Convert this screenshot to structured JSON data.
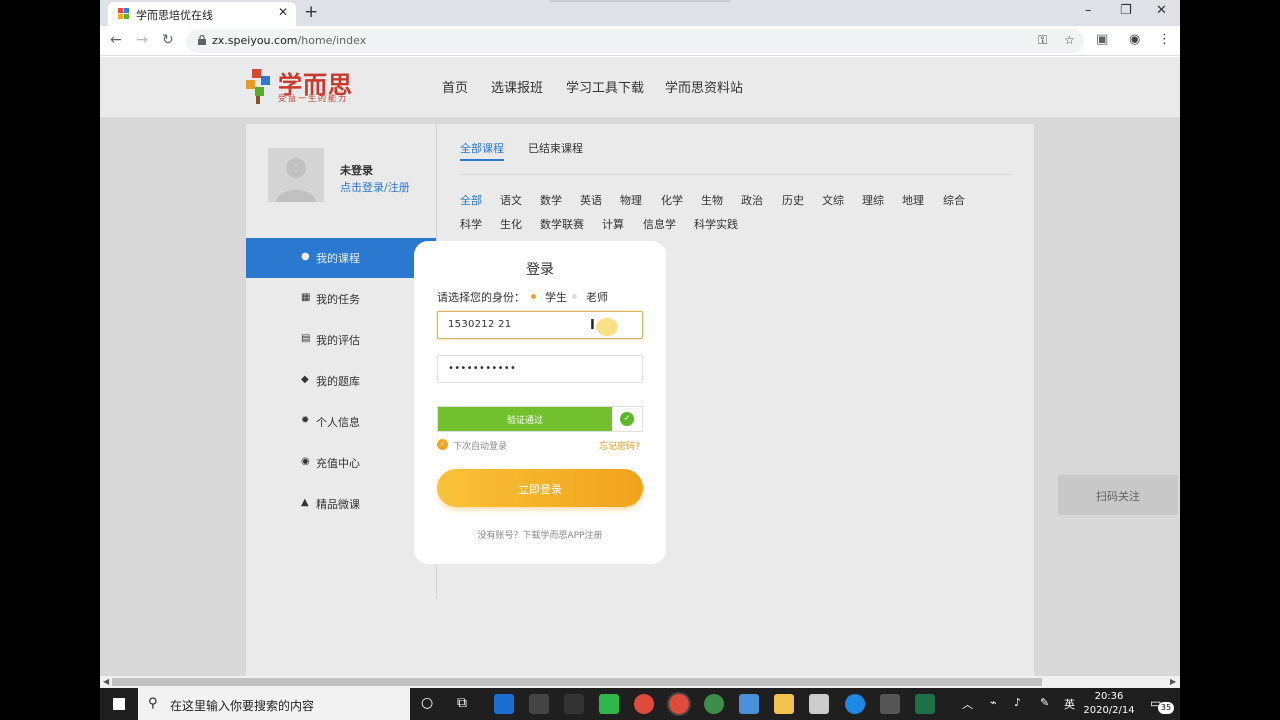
{
  "browser": {
    "tab_title": "学而思培优在线",
    "tab_close": "✕",
    "new_tab": "+",
    "url_host": "zx.speiyou.com",
    "url_path": "/home/index",
    "window_minimize": "–",
    "window_restore": "❐",
    "window_close": "✕"
  },
  "site": {
    "logo_text": "学而思",
    "logo_slogan": "受益一生的能力",
    "nav": [
      "首页",
      "选课报班",
      "学习工具下载",
      "学而思资料站"
    ]
  },
  "user": {
    "name": "未登录",
    "login_link": "点击登录/注册"
  },
  "sidebar": {
    "items": [
      {
        "label": "我的课程",
        "icon": "user-icon"
      },
      {
        "label": "我的任务",
        "icon": "task-icon"
      },
      {
        "label": "我的评估",
        "icon": "assessment-icon"
      },
      {
        "label": "我的题库",
        "icon": "question-bank-icon"
      },
      {
        "label": "个人信息",
        "icon": "gear-icon"
      },
      {
        "label": "充值中心",
        "icon": "recharge-icon"
      },
      {
        "label": "精品微课",
        "icon": "graduation-cap-icon"
      }
    ],
    "active": 0
  },
  "courses": {
    "tabs": [
      "全部课程",
      "已结束课程"
    ],
    "subjects_row1": [
      "全部",
      "语文",
      "数学",
      "英语",
      "物理",
      "化学",
      "生物",
      "政治",
      "历史",
      "文综",
      "理综",
      "地理",
      "综合"
    ],
    "subjects_row2": [
      "科学",
      "生化",
      "数学联赛",
      "计算",
      "信息学",
      "科学实践"
    ]
  },
  "scan_follow": "扫码关注",
  "login_modal": {
    "title": "登录",
    "role_prompt": "请选择您的身份：",
    "roles": [
      "学生",
      "老师"
    ],
    "selected_role": "学生",
    "phone_value": "1530212 21",
    "password_value": "•••••••••••",
    "verify_text": "验证通过",
    "remember_label": "下次自动登录",
    "forgot_label": "忘记密码?",
    "submit_label": "立即登录",
    "register_hint": "没有账号？下载学而思APP注册"
  },
  "taskbar": {
    "search_placeholder": "在这里输入你要搜索的内容",
    "ime": "英",
    "time": "20:36",
    "date": "2020/2/14",
    "notification_count": "35"
  },
  "colors": {
    "accent_blue": "#2c7fe0",
    "login_orange": "#f2a21b",
    "verify_green": "#73c02f",
    "brand_red": "#d83b2f"
  }
}
